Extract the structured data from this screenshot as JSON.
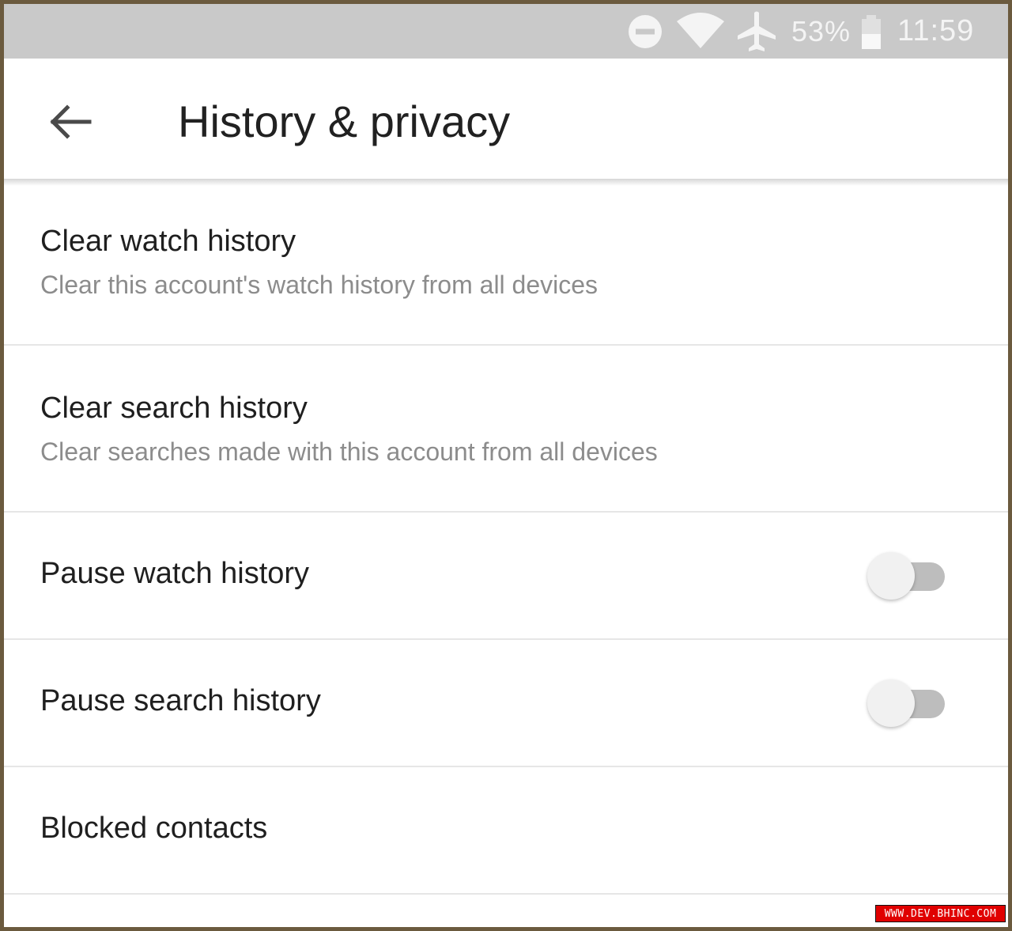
{
  "status_bar": {
    "icons": [
      "do-not-disturb-icon",
      "wifi-icon",
      "airplane-mode-icon",
      "battery-icon"
    ],
    "battery": "53%",
    "time": "11:59"
  },
  "app_bar": {
    "back_icon": "arrow-left-icon",
    "title": "History & privacy"
  },
  "settings": {
    "items": [
      {
        "title": "Clear watch history",
        "subtitle": "Clear this account's watch history from all devices"
      },
      {
        "title": "Clear search history",
        "subtitle": "Clear searches made with this account from all devices"
      },
      {
        "title": "Pause watch history",
        "toggle_on": false
      },
      {
        "title": "Pause search history",
        "toggle_on": false
      },
      {
        "title": "Blocked contacts"
      }
    ]
  },
  "watermark": "WWW.DEV.BHINC.COM",
  "colors": {
    "status_bar": "#c9c9c9",
    "title_text": "#212121",
    "subtitle_text": "#8c8c8c",
    "toggle_track": "#bdbdbd",
    "toggle_thumb": "#f1f1f1",
    "frame": "#6b5a3e"
  }
}
